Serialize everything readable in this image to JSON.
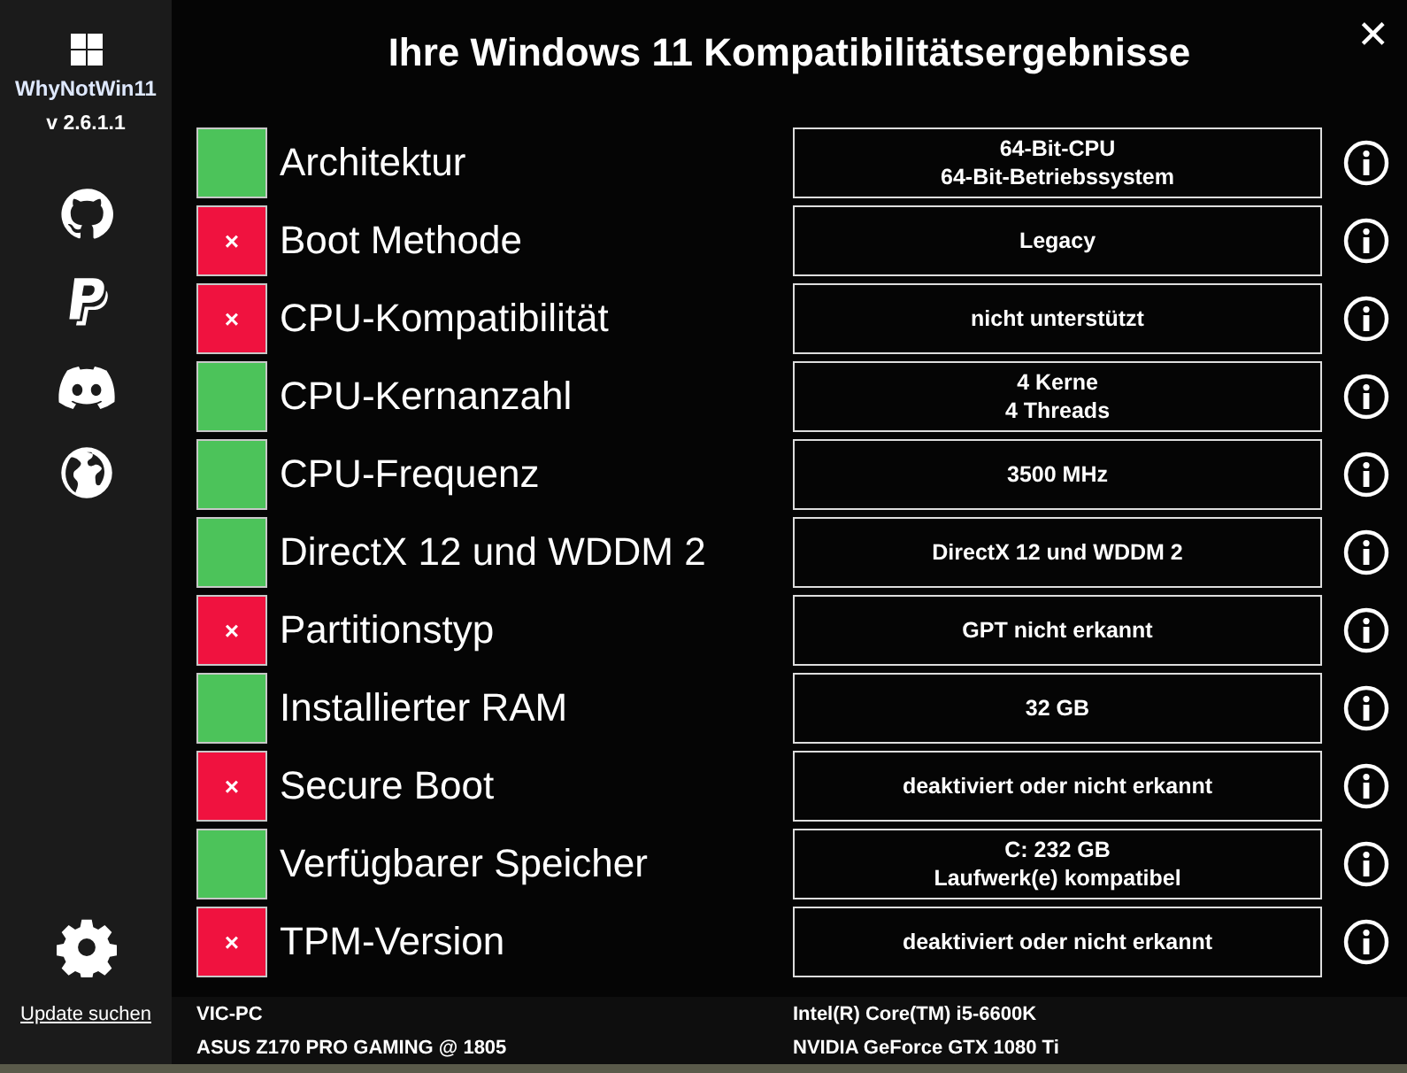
{
  "sidebar": {
    "app_name": "WhyNotWin11",
    "version": "v 2.6.1.1",
    "update_link": "Update suchen"
  },
  "title": "Ihre Windows 11 Kompatibilitätsergebnisse",
  "close": "✕",
  "checks": [
    {
      "label": "Architektur",
      "passed": true,
      "value": [
        "64-Bit-CPU",
        "64-Bit-Betriebssystem"
      ]
    },
    {
      "label": "Boot Methode",
      "passed": false,
      "mark": "×",
      "value": [
        "Legacy"
      ]
    },
    {
      "label": "CPU-Kompatibilität",
      "passed": false,
      "mark": "×",
      "value": [
        "nicht unterstützt"
      ]
    },
    {
      "label": "CPU-Kernanzahl",
      "passed": true,
      "value": [
        "4 Kerne",
        "4 Threads"
      ]
    },
    {
      "label": "CPU-Frequenz",
      "passed": true,
      "value": [
        "3500 MHz"
      ]
    },
    {
      "label": "DirectX 12 und WDDM 2",
      "passed": true,
      "value": [
        "DirectX 12 und WDDM 2"
      ]
    },
    {
      "label": "Partitionstyp",
      "passed": false,
      "mark": "×",
      "value": [
        "GPT nicht erkannt"
      ]
    },
    {
      "label": "Installierter RAM",
      "passed": true,
      "value": [
        "32 GB"
      ]
    },
    {
      "label": "Secure Boot",
      "passed": false,
      "mark": "×",
      "value": [
        "deaktiviert oder nicht erkannt"
      ]
    },
    {
      "label": "Verfügbarer Speicher",
      "passed": true,
      "value": [
        "C: 232 GB",
        "Laufwerk(e) kompatibel"
      ]
    },
    {
      "label": "TPM-Version",
      "passed": false,
      "mark": "×",
      "value": [
        "deaktiviert oder nicht erkannt"
      ]
    }
  ],
  "footer": {
    "left": [
      "VIC-PC",
      "ASUS Z170 PRO GAMING @ 1805"
    ],
    "right": [
      "Intel(R) Core(TM) i5-6600K",
      "NVIDIA GeForce GTX 1080 Ti"
    ]
  }
}
